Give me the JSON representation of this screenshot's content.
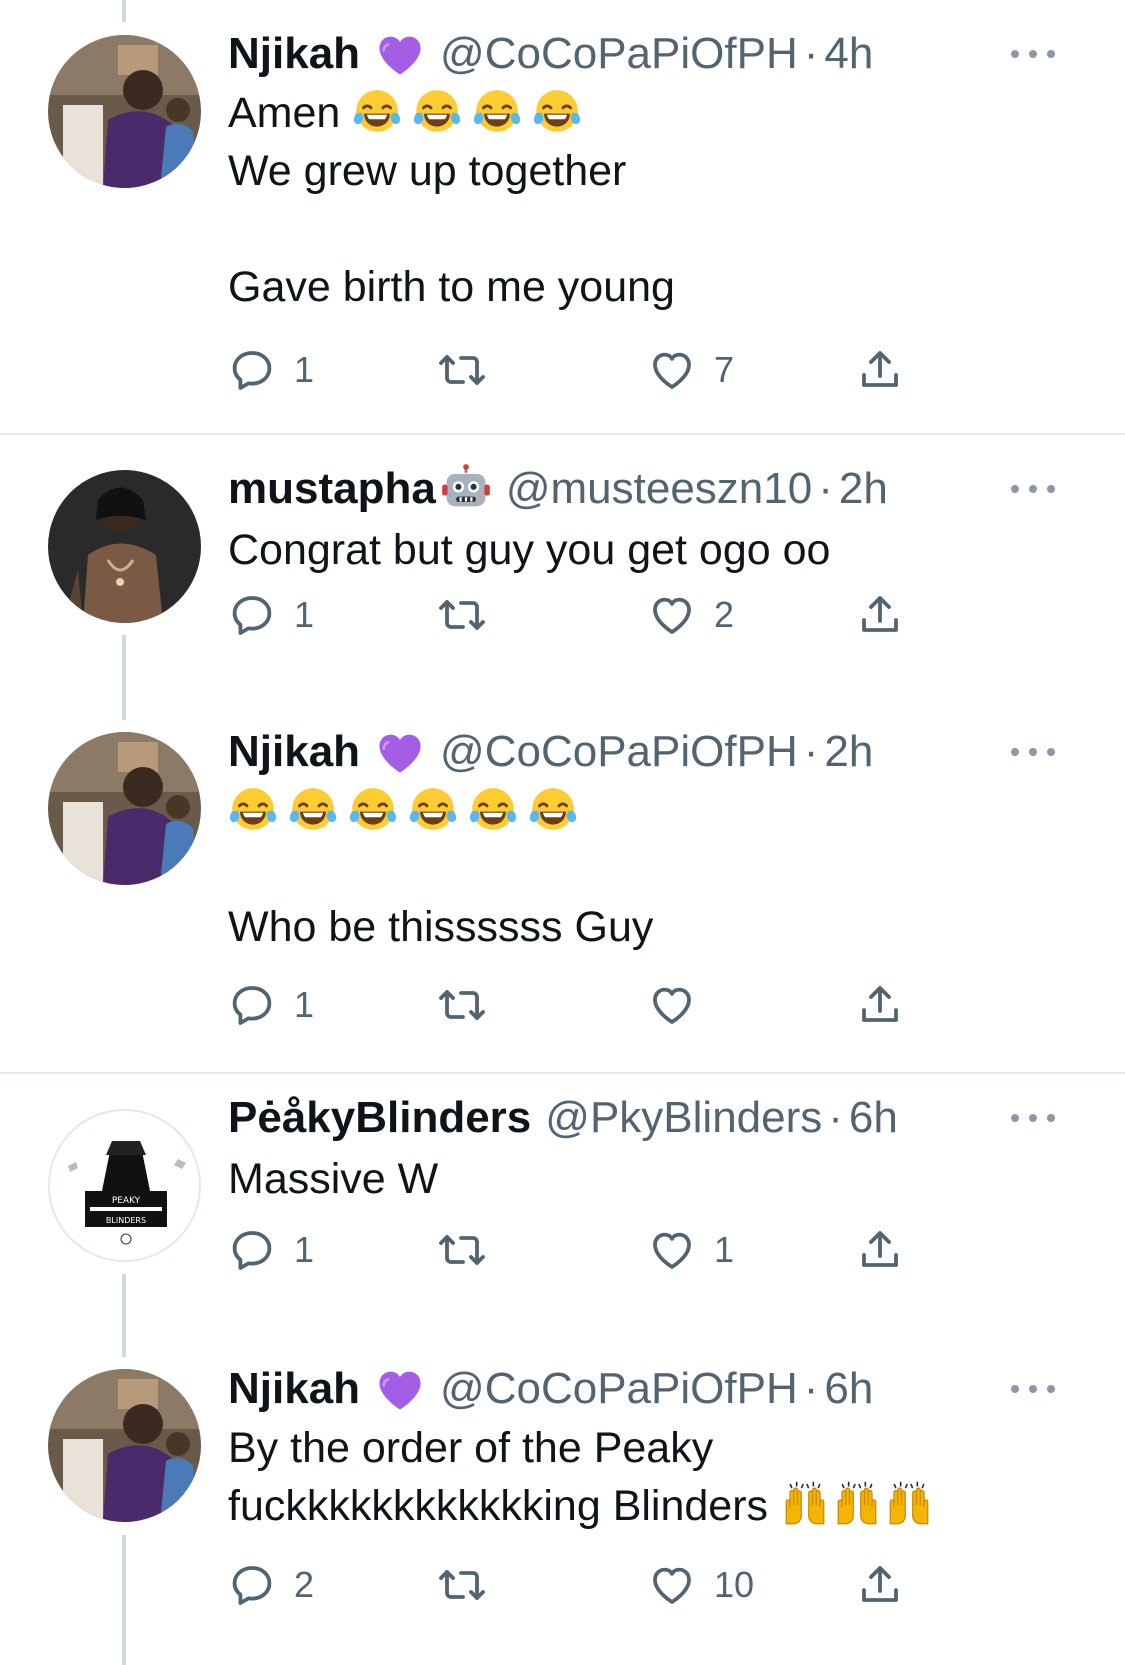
{
  "tweets": [
    {
      "name": "Njikah",
      "handle": "@CoCoPaPiOfPH",
      "time": "4h",
      "text_line1": "Amen",
      "text_body": "We grew up together\n\nGave birth to me young",
      "replies": "1",
      "retweets": "",
      "likes": "7"
    },
    {
      "name": "mustapha",
      "handle": "@musteeszn10",
      "time": "2h",
      "text": "Congrat but guy you get ogo oo",
      "replies": "1",
      "retweets": "",
      "likes": "2"
    },
    {
      "name": "Njikah",
      "handle": "@CoCoPaPiOfPH",
      "time": "2h",
      "text": "Who be thissssss Guy",
      "replies": "1",
      "retweets": "",
      "likes": ""
    },
    {
      "name": "PėåkyBlinders",
      "handle": "@PkyBlinders",
      "time": "6h",
      "text": "Massive W",
      "replies": "1",
      "retweets": "",
      "likes": "1",
      "avatar_text_top": "PEAKY",
      "avatar_text_bottom": "BLINDERS"
    },
    {
      "name": "Njikah",
      "handle": "@CoCoPaPiOfPH",
      "time": "6h",
      "text_line1": "By the order of the Peaky",
      "text_line2": "fuckkkkkkkkkkkking Blinders",
      "replies": "2",
      "retweets": "",
      "likes": "10"
    }
  ],
  "separator": "·",
  "icons": {
    "reply": "reply-icon",
    "retweet": "retweet-icon",
    "like": "heart-icon",
    "share": "share-icon",
    "more": "more-icon",
    "badge_heart": "purple-heart-icon",
    "badge_robot": "robot-icon",
    "joy": "joy-emoji",
    "raised_hands": "raised-hands-emoji"
  },
  "colors": {
    "text": "#0f1419",
    "secondary": "#536471",
    "thread_line": "#cfd9de",
    "divider": "#e1e8ed",
    "purple_heart": "#a45ee6"
  }
}
